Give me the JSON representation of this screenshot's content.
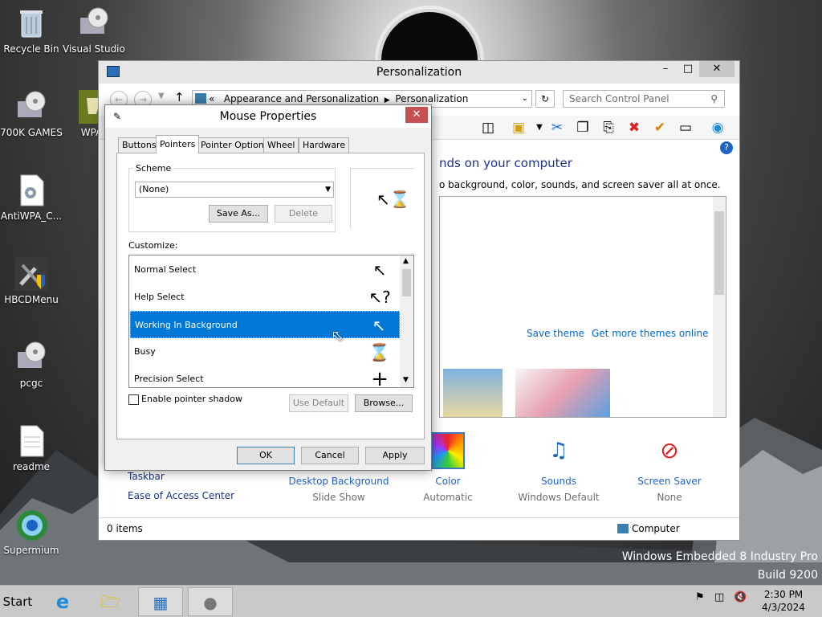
{
  "desktop": {
    "icons": [
      {
        "label": "Recycle Bin"
      },
      {
        "label": "Visual Studio 201"
      },
      {
        "label": "700K GAMES"
      },
      {
        "label": "WPA_"
      },
      {
        "label": "AntiWPA_C..."
      },
      {
        "label": "HBCDMenu"
      },
      {
        "label": "pcgc"
      },
      {
        "label": "readme"
      },
      {
        "label": "Supermium"
      }
    ],
    "os_name": "Windows Embedded 8 Industry Pro",
    "build": "Build 9200"
  },
  "personalization": {
    "title": "Personalization",
    "breadcrumb": [
      "Appearance and Personalization",
      "Personalization"
    ],
    "search_placeholder": "Search Control Panel",
    "heading": "nds on your computer",
    "subheading": "o background, color, sounds, and screen saver all at once.",
    "links": {
      "save_theme": "Save theme",
      "get_more": "Get more themes online"
    },
    "left_links": [
      "Taskbar",
      "Ease of Access Center"
    ],
    "bottom_items": [
      {
        "title": "Desktop Background",
        "value": "Slide Show"
      },
      {
        "title": "Color",
        "value": "Automatic"
      },
      {
        "title": "Sounds",
        "value": "Windows Default"
      },
      {
        "title": "Screen Saver",
        "value": "None"
      }
    ],
    "status_items": "0 items",
    "status_location": "Computer"
  },
  "mouse_properties": {
    "title": "Mouse Properties",
    "tabs": [
      "Buttons",
      "Pointers",
      "Pointer Options",
      "Wheel",
      "Hardware"
    ],
    "active_tab": "Pointers",
    "scheme_label": "Scheme",
    "scheme_value": "(None)",
    "save_as": "Save As...",
    "delete": "Delete",
    "customize_label": "Customize:",
    "cursors": [
      {
        "name": "Normal Select",
        "icon": "arrow-cursor"
      },
      {
        "name": "Help Select",
        "icon": "help-cursor"
      },
      {
        "name": "Working In Background",
        "icon": "working-cursor"
      },
      {
        "name": "Busy",
        "icon": "hourglass-cursor"
      },
      {
        "name": "Precision Select",
        "icon": "crosshair-cursor"
      }
    ],
    "selected_cursor": "Working In Background",
    "shadow_label": "Enable pointer shadow",
    "use_default": "Use Default",
    "browse": "Browse...",
    "ok": "OK",
    "cancel": "Cancel",
    "apply": "Apply"
  },
  "taskbar": {
    "start": "Start",
    "time": "2:30 PM",
    "date": "4/3/2024"
  }
}
